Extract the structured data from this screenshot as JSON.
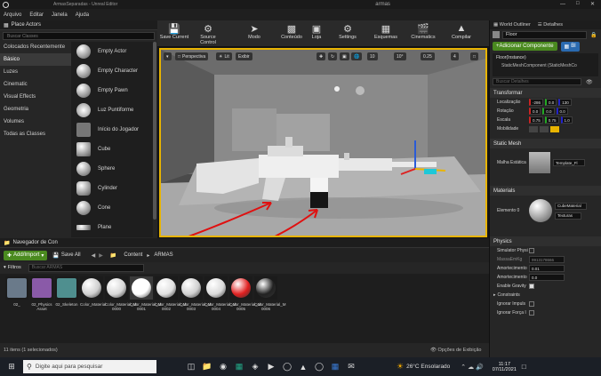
{
  "window": {
    "title": "ArmasSeparadas - Unreal Editor",
    "project": "armas"
  },
  "menu": [
    "Arquivo",
    "Editar",
    "Janela",
    "Ajuda"
  ],
  "place_actors": {
    "tab": "Place Actors",
    "search_placeholder": "Buscar Classes",
    "categories": [
      "Colocados Recentemente",
      "Básico",
      "Luzes",
      "Cinematic",
      "Visual Effects",
      "Geometria",
      "Volumes",
      "Todas as Classes"
    ],
    "selected_category": "Básico",
    "actors": [
      "Empty Actor",
      "Empty Character",
      "Empty Pawn",
      "Luz Puntiforme",
      "Início do Jogador",
      "Cube",
      "Sphere",
      "Cylinder",
      "Cone",
      "Plane"
    ]
  },
  "toolbar": {
    "buttons": [
      "Save Current",
      "Source Control",
      "Modo",
      "Conteúdo",
      "Loja",
      "Settings",
      "Esquemas",
      "Cinematics",
      "Compilar"
    ]
  },
  "viewport": {
    "perspective": "Perspectiva",
    "lit": "Lit",
    "show": "Exibir",
    "snap_values": [
      "10",
      "10°",
      "0.25",
      "4"
    ]
  },
  "content_browser": {
    "tab": "Navegador de Con",
    "add_import": "Add/Import",
    "save_all": "Save All",
    "path": [
      "Content",
      "ARMAS"
    ],
    "filters": "Filtros",
    "search_placeholder": "Buscar ARMAS",
    "assets": [
      {
        "name": "02_",
        "color": "#6a7a8a"
      },
      {
        "name": "02_Physics Asset",
        "color": "#8a5aa8"
      },
      {
        "name": "02_Skeleton",
        "color": "#4f8f8f"
      },
      {
        "name": "Color_Material",
        "color": "#cfcfcf"
      },
      {
        "name": "Color_Material_M 0000",
        "color": "#d8d8d8"
      },
      {
        "name": "Color_Material_M 0001",
        "color": "#ffffff"
      },
      {
        "name": "Color_Material_M 0002",
        "color": "#e0e0e0"
      },
      {
        "name": "Color_Material_M 0003",
        "color": "#d0d0d0"
      },
      {
        "name": "Color_Material_M 0004",
        "color": "#dadada"
      },
      {
        "name": "Color_Material_M 0005",
        "color": "#e02020"
      },
      {
        "name": "Color_Material_M 0006",
        "color": "#222222"
      }
    ],
    "status": "11 itens (1 selecionados)",
    "view_options": "Opções de Exibição"
  },
  "outliner": {
    "tabs": [
      "World Outliner",
      "Detalhes"
    ],
    "name_value": "Floor",
    "add_component": "+Adicionar Componente",
    "bp_label": "Bl",
    "instance": "Floor(Instance)",
    "component": "StaticMeshComponent (StaticMeshCo",
    "search_placeholder": "Buscar Detalhes"
  },
  "details": {
    "transform_header": "Transformar",
    "location_label": "Localização",
    "location": [
      "-286",
      "0.0",
      "130"
    ],
    "rotation_label": "Rotação",
    "rotation": [
      "0.0",
      "0.0",
      "0.0"
    ],
    "scale_label": "Escala",
    "scale": [
      "0.75",
      "0.75",
      "1.0"
    ],
    "mobility_label": "Mobilidade",
    "static_mesh_header": "Static Mesh",
    "mesh_label": "Malha Estática",
    "mesh_value": "Template_Fl",
    "materials_header": "Materials",
    "element_label": "Elemento 0",
    "material_value": "CubeMaterial",
    "texture_button": "Texturas",
    "physics_header": "Physics",
    "simulate_label": "Simulator Physi",
    "mass_label": "MassaEmKg",
    "mass_value": "9913178666",
    "linear_damping_label": "Amortecimento",
    "linear_damping_value": "0.01",
    "angular_damping_label": "Amortecimento",
    "angular_damping_value": "0.0",
    "gravity_label": "Enable Gravity",
    "constraints_label": "Constraints",
    "ignore_impulse_label": "Ignorar Impuls",
    "ignore_force_label": "Ignorar Força I"
  },
  "taskbar": {
    "search_placeholder": "Digite aqui para pesquisar",
    "weather": "26°C Ensolarado",
    "time": "11:17",
    "date": "07/11/2021"
  }
}
